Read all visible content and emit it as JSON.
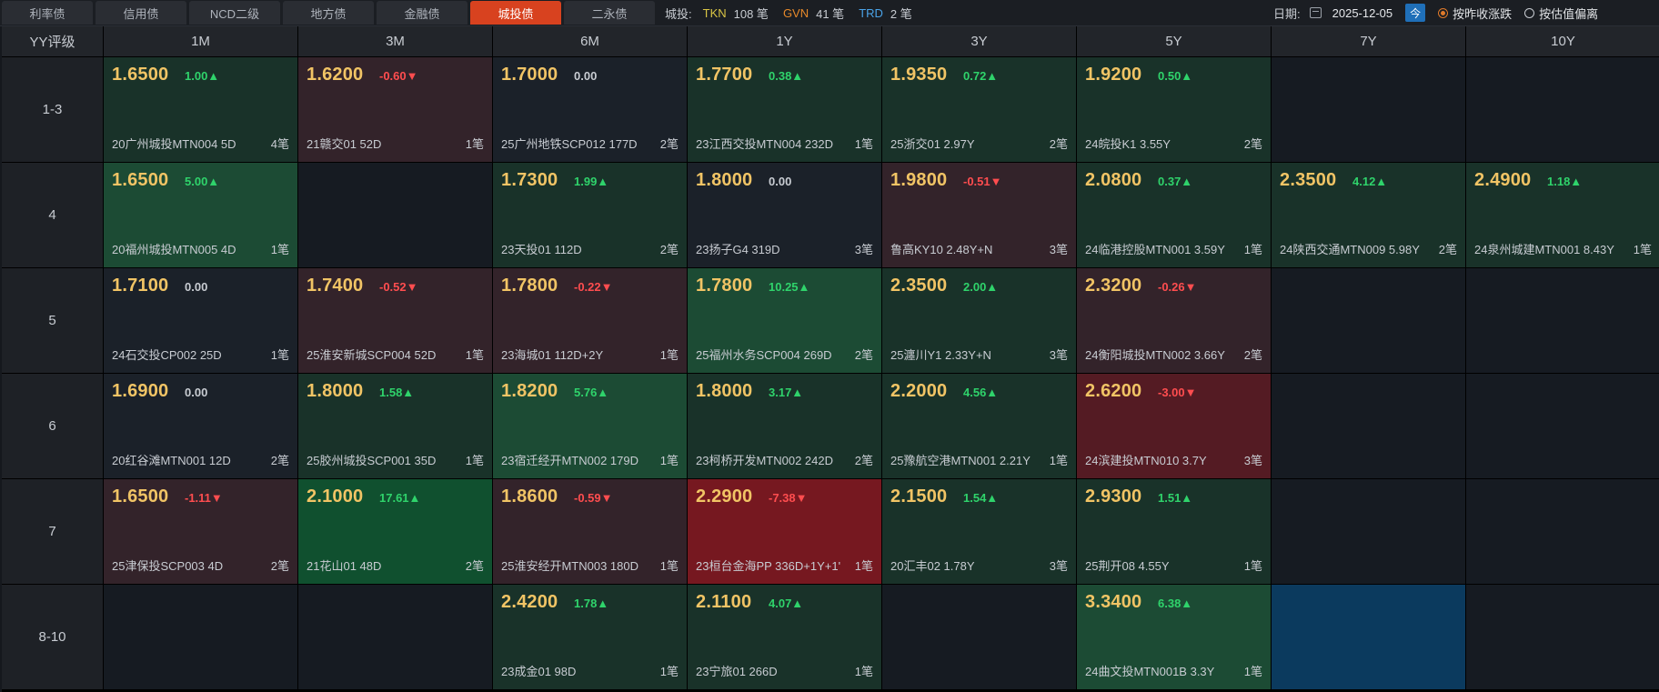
{
  "tabs": [
    {
      "label": "利率债",
      "active": false
    },
    {
      "label": "信用债",
      "active": false
    },
    {
      "label": "NCD二级",
      "active": false
    },
    {
      "label": "地方债",
      "active": false
    },
    {
      "label": "金融债",
      "active": false
    },
    {
      "label": "城投债",
      "active": true
    },
    {
      "label": "二永债",
      "active": false
    }
  ],
  "summary": {
    "label": "城投:",
    "tkn_key": "TKN",
    "tkn_count": "108 笔",
    "gvn_key": "GVN",
    "gvn_count": "41 笔",
    "trd_key": "TRD",
    "trd_count": "2 笔"
  },
  "date": {
    "label": "日期:",
    "value": "2025-12-05",
    "today_btn": "今"
  },
  "options": [
    {
      "label": "按昨收涨跌",
      "selected": true
    },
    {
      "label": "按估值偏离",
      "selected": false
    }
  ],
  "colors": {
    "up": "#2fd36b",
    "down": "#ff4d4f",
    "price": "#f1c465",
    "active_tab": "#d8421f"
  },
  "grid": {
    "corner": "YY评级",
    "columns": [
      "1M",
      "3M",
      "6M",
      "1Y",
      "3Y",
      "5Y",
      "7Y",
      "10Y"
    ],
    "rows": [
      {
        "label": "1-3",
        "cells": [
          {
            "price": "1.6500",
            "change": "1.00▲",
            "dir": "up",
            "tone": "up",
            "bond": "20广州城投MTN004 5D",
            "count": "4笔"
          },
          {
            "price": "1.6200",
            "change": "-0.60▼",
            "dir": "down",
            "tone": "down",
            "bond": "21赣交01 52D",
            "count": "1笔"
          },
          {
            "price": "1.7000",
            "change": "0.00",
            "dir": "flat",
            "tone": "neutral",
            "bond": "25广州地铁SCP012 177D",
            "count": "2笔"
          },
          {
            "price": "1.7700",
            "change": "0.38▲",
            "dir": "up",
            "tone": "up",
            "bond": "23江西交投MTN004 232D",
            "count": "1笔"
          },
          {
            "price": "1.9350",
            "change": "0.72▲",
            "dir": "up",
            "tone": "up",
            "bond": "25浙交01 2.97Y",
            "count": "2笔"
          },
          {
            "price": "1.9200",
            "change": "0.50▲",
            "dir": "up",
            "tone": "up",
            "bond": "24皖投K1 3.55Y",
            "count": "2笔"
          },
          null,
          null
        ]
      },
      {
        "label": "4",
        "cells": [
          {
            "price": "1.6500",
            "change": "5.00▲",
            "dir": "up",
            "tone": "upstrong",
            "bond": "20福州城投MTN005 4D",
            "count": "1笔"
          },
          null,
          {
            "price": "1.7300",
            "change": "1.99▲",
            "dir": "up",
            "tone": "up",
            "bond": "23天投01 112D",
            "count": "2笔"
          },
          {
            "price": "1.8000",
            "change": "0.00",
            "dir": "flat",
            "tone": "neutral",
            "bond": "23扬子G4 319D",
            "count": "3笔"
          },
          {
            "price": "1.9800",
            "change": "-0.51▼",
            "dir": "down",
            "tone": "down",
            "bond": "鲁高KY10 2.48Y+N",
            "count": "3笔"
          },
          {
            "price": "2.0800",
            "change": "0.37▲",
            "dir": "up",
            "tone": "up",
            "bond": "24临港控股MTN001 3.59Y",
            "count": "1笔"
          },
          {
            "price": "2.3500",
            "change": "4.12▲",
            "dir": "up",
            "tone": "up",
            "bond": "24陕西交通MTN009 5.98Y",
            "count": "2笔"
          },
          {
            "price": "2.4900",
            "change": "1.18▲",
            "dir": "up",
            "tone": "up",
            "bond": "24泉州城建MTN001 8.43Y",
            "count": "1笔"
          }
        ]
      },
      {
        "label": "5",
        "cells": [
          {
            "price": "1.7100",
            "change": "0.00",
            "dir": "flat",
            "tone": "neutral",
            "bond": "24石交投CP002 25D",
            "count": "1笔"
          },
          {
            "price": "1.7400",
            "change": "-0.52▼",
            "dir": "down",
            "tone": "down",
            "bond": "25淮安新城SCP004 52D",
            "count": "1笔"
          },
          {
            "price": "1.7800",
            "change": "-0.22▼",
            "dir": "down",
            "tone": "down",
            "bond": "23海城01 112D+2Y",
            "count": "1笔"
          },
          {
            "price": "1.7800",
            "change": "10.25▲",
            "dir": "up",
            "tone": "upstrong",
            "bond": "25福州水务SCP004 269D",
            "count": "2笔"
          },
          {
            "price": "2.3500",
            "change": "2.00▲",
            "dir": "up",
            "tone": "up",
            "bond": "25瀍川Y1 2.33Y+N",
            "count": "3笔"
          },
          {
            "price": "2.3200",
            "change": "-0.26▼",
            "dir": "down",
            "tone": "down",
            "bond": "24衡阳城投MTN002 3.66Y",
            "count": "2笔"
          },
          null,
          null
        ]
      },
      {
        "label": "6",
        "cells": [
          {
            "price": "1.6900",
            "change": "0.00",
            "dir": "flat",
            "tone": "neutral",
            "bond": "20红谷滩MTN001 12D",
            "count": "2笔"
          },
          {
            "price": "1.8000",
            "change": "1.58▲",
            "dir": "up",
            "tone": "up",
            "bond": "25胶州城投SCP001 35D",
            "count": "1笔"
          },
          {
            "price": "1.8200",
            "change": "5.76▲",
            "dir": "up",
            "tone": "upstrong",
            "bond": "23宿迁经开MTN002 179D",
            "count": "1笔"
          },
          {
            "price": "1.8000",
            "change": "3.17▲",
            "dir": "up",
            "tone": "up",
            "bond": "23柯桥开发MTN002 242D",
            "count": "2笔"
          },
          {
            "price": "2.2000",
            "change": "4.56▲",
            "dir": "up",
            "tone": "up",
            "bond": "25豫航空港MTN001 2.21Y",
            "count": "1笔"
          },
          {
            "price": "2.6200",
            "change": "-3.00▼",
            "dir": "down",
            "tone": "downstrong",
            "bond": "24滨建投MTN010 3.7Y",
            "count": "3笔"
          },
          null,
          null
        ]
      },
      {
        "label": "7",
        "cells": [
          {
            "price": "1.6500",
            "change": "-1.11▼",
            "dir": "down",
            "tone": "down",
            "bond": "25津保投SCP003 4D",
            "count": "2笔"
          },
          {
            "price": "2.1000",
            "change": "17.61▲",
            "dir": "up",
            "tone": "upmax",
            "bond": "21花山01 48D",
            "count": "2笔"
          },
          {
            "price": "1.8600",
            "change": "-0.59▼",
            "dir": "down",
            "tone": "down",
            "bond": "25淮安经开MTN003 180D",
            "count": "1笔"
          },
          {
            "price": "2.2900",
            "change": "-7.38▼",
            "dir": "down",
            "tone": "downmax",
            "bond": "23桓台金海PP 336D+1Y+1'",
            "count": "1笔"
          },
          {
            "price": "2.1500",
            "change": "1.54▲",
            "dir": "up",
            "tone": "up",
            "bond": "20汇丰02 1.78Y",
            "count": "3笔"
          },
          {
            "price": "2.9300",
            "change": "1.51▲",
            "dir": "up",
            "tone": "up",
            "bond": "25荆开08 4.55Y",
            "count": "1笔"
          },
          null,
          null
        ]
      },
      {
        "label": "8-10",
        "cells": [
          null,
          null,
          {
            "price": "2.4200",
            "change": "1.78▲",
            "dir": "up",
            "tone": "up",
            "bond": "23成金01 98D",
            "count": "1笔"
          },
          {
            "price": "2.1100",
            "change": "4.07▲",
            "dir": "up",
            "tone": "up",
            "bond": "23宁旅01 266D",
            "count": "1笔"
          },
          null,
          {
            "price": "3.3400",
            "change": "6.38▲",
            "dir": "up",
            "tone": "upstrong",
            "bond": "24曲文投MTN001B 3.3Y",
            "count": "1笔"
          },
          {
            "highlight": "blue"
          },
          null
        ]
      }
    ]
  }
}
